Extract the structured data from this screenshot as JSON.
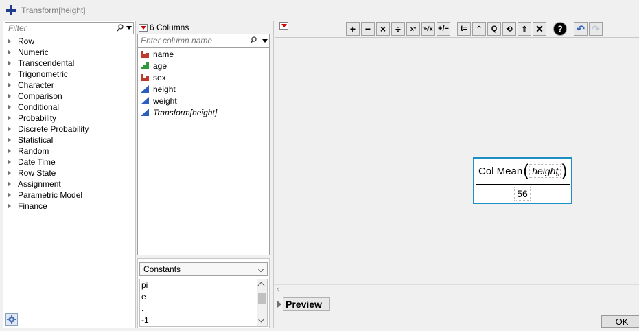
{
  "window": {
    "title": "Transform[height]"
  },
  "functions": {
    "filter_placeholder": "Filter",
    "categories": [
      "Row",
      "Numeric",
      "Transcendental",
      "Trigonometric",
      "Character",
      "Comparison",
      "Conditional",
      "Probability",
      "Discrete Probability",
      "Statistical",
      "Random",
      "Date Time",
      "Row State",
      "Assignment",
      "Parametric Model",
      "Finance"
    ]
  },
  "columns": {
    "header": "6 Columns",
    "search_placeholder": "Enter column name",
    "items": [
      {
        "label": "name",
        "icon": "nominal-icon",
        "color": "#c0392b"
      },
      {
        "label": "age",
        "icon": "ordinal-icon",
        "color": "#2e9b3a"
      },
      {
        "label": "sex",
        "icon": "nominal-icon",
        "color": "#c0392b"
      },
      {
        "label": "height",
        "icon": "continuous-icon",
        "color": "#2b5fbf"
      },
      {
        "label": "weight",
        "icon": "continuous-icon",
        "color": "#2b5fbf"
      },
      {
        "label": "Transform[height]",
        "icon": "continuous-icon",
        "color": "#2b5fbf",
        "italic": true
      }
    ]
  },
  "constants": {
    "selected": "Constants",
    "items": [
      "pi",
      "e",
      ".",
      "-1"
    ]
  },
  "editor": {
    "function_name": "Col Mean",
    "argument": "height",
    "result": "56",
    "formula_border_color": "#1c8fc4"
  },
  "preview": {
    "label": "Preview"
  },
  "ok_label": "OK"
}
